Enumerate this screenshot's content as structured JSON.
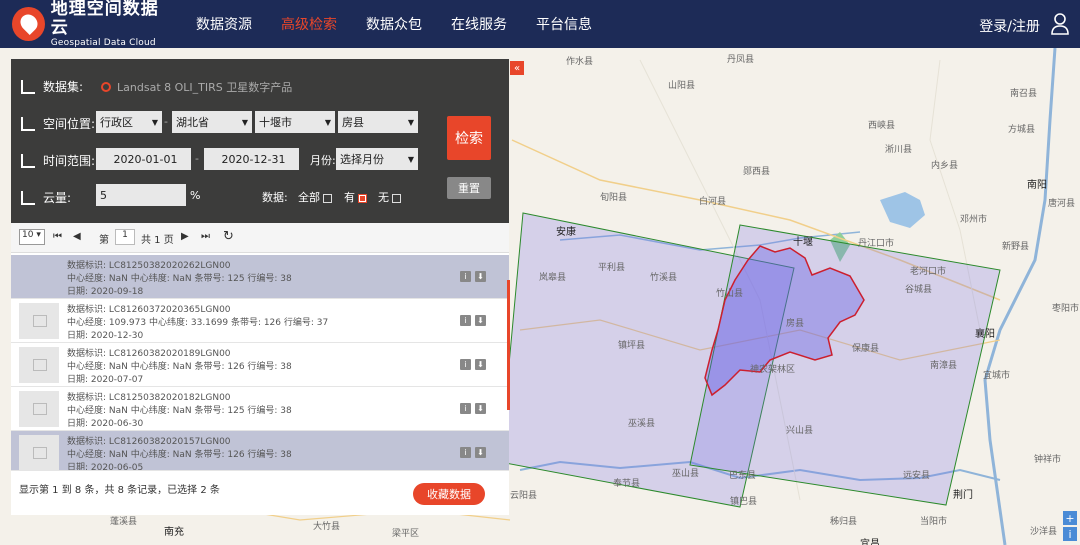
{
  "header": {
    "logo_cn": "地理空间数据云",
    "logo_en": "Geospatial Data Cloud",
    "nav": [
      "数据资源",
      "高级检索",
      "数据众包",
      "在线服务",
      "平台信息"
    ],
    "active_nav": 1,
    "login": "登录/注册"
  },
  "colors": {
    "header_bg": "#1d2b57",
    "accent": "#e8462a",
    "footprint": "#2c8a2c",
    "boundary": "#cc1f2e"
  },
  "panel": {
    "dataset_label": "数据集:",
    "dataset_value": "Landsat 8 OLI_TIRS 卫星数字产品",
    "location_label": "空间位置:",
    "location_type": "行政区",
    "province": "湖北省",
    "city": "十堰市",
    "county": "房县",
    "time_label": "时间范围:",
    "start_date": "2020-01-01",
    "end_date": "2020-12-31",
    "month_label": "月份:",
    "month_value": "选择月份",
    "cloud_label": "云量:",
    "cloud_value": "5",
    "cloud_unit": "%",
    "data_label": "数据:",
    "opt_all": "全部",
    "opt_yes": "有",
    "opt_no": "无",
    "search": "检索",
    "reset": "重置",
    "collapse": "«",
    "dash": "-"
  },
  "pager": {
    "page_size": "10",
    "page_prefix": "第",
    "page": "1",
    "page_total": "共 1 页"
  },
  "records": [
    {
      "l1": "数据标识:  LC81250382020262LGN00",
      "l2": "中心经度:   NaN 中心纬度:   NaN 条带号: 125 行编号: 38",
      "l3": "日期:   2020-09-18",
      "selected": true
    },
    {
      "l1": "数据标识:  LC81260372020365LGN00",
      "l2": "中心经度:   109.973 中心纬度:   33.1699 条带号: 126 行编号: 37",
      "l3": "日期:   2020-12-30",
      "selected": false
    },
    {
      "l1": "数据标识:  LC81260382020189LGN00",
      "l2": "中心经度:   NaN 中心纬度:   NaN 条带号: 126 行编号: 38",
      "l3": "日期:   2020-07-07",
      "selected": false
    },
    {
      "l1": "数据标识:  LC81250382020182LGN00",
      "l2": "中心经度:   NaN 中心纬度:   NaN 条带号: 125 行编号: 38",
      "l3": "日期:   2020-06-30",
      "selected": false
    },
    {
      "l1": "数据标识:  LC81260382020157LGN00",
      "l2": "中心经度:   NaN 中心纬度:   NaN 条带号: 126 行编号: 38",
      "l3": "日期:   2020-06-05",
      "selected": true
    }
  ],
  "footer": {
    "summary": "显示第 1 到 8 条，共 8 条记录，已选择 2 条",
    "collect": "收藏数据"
  },
  "map": {
    "cities": [
      "安康",
      "十堰",
      "襄阳",
      "南阳",
      "荆门",
      "宜昌",
      "南充"
    ],
    "towns": [
      "作水县",
      "丹凤县",
      "山阳县",
      "西峡县",
      "南召县",
      "淅川县",
      "内乡县",
      "郧西县",
      "白河县",
      "旬阳县",
      "镇坪县",
      "平利县",
      "岚皋县",
      "竹溪县",
      "竹山县",
      "房县",
      "保康县",
      "神农架林区",
      "兴山县",
      "巫溪县",
      "巫山县",
      "巴东县",
      "奉节县",
      "云阳县",
      "远安县",
      "南漳县",
      "谷城县",
      "老河口市",
      "丹江口市",
      "邓州市",
      "新野县",
      "枣阳市",
      "宜城市",
      "钟祥市",
      "沙洋县",
      "当阳市",
      "秭归县",
      "蓬溪县",
      "大竹县",
      "梁平区",
      "镇巴县",
      "方城县",
      "唐河县"
    ]
  }
}
